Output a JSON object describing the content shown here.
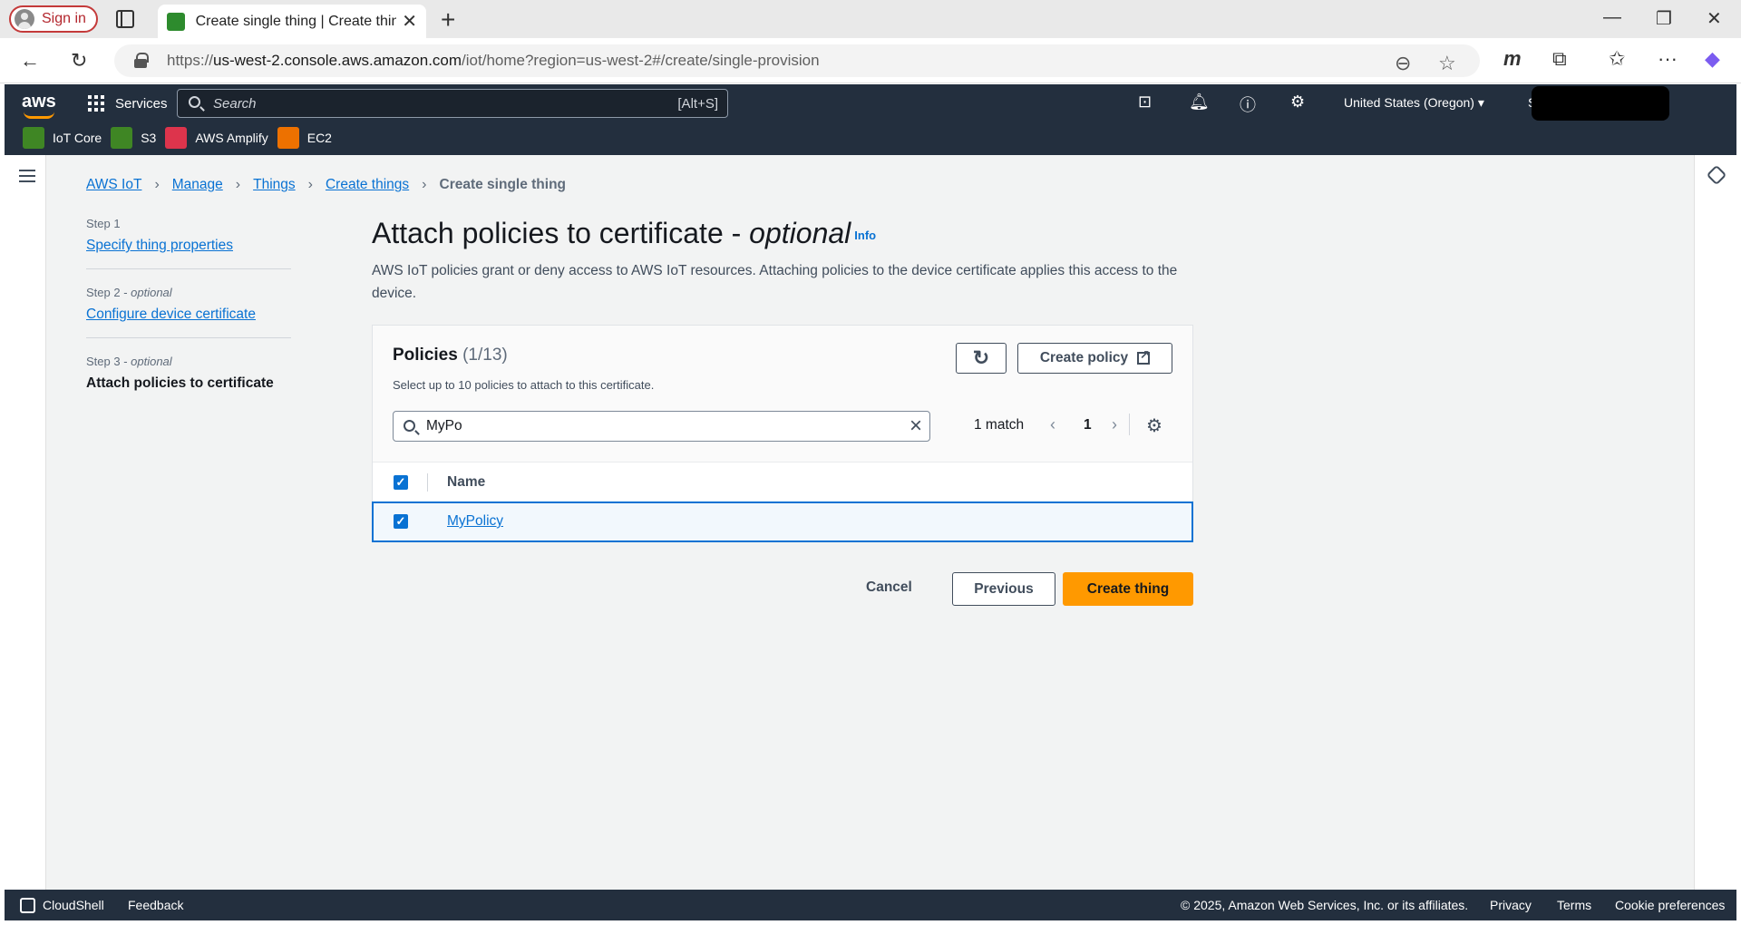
{
  "browser": {
    "signin_label": "Sign in",
    "tab_title": "Create single thing | Create things",
    "url_prefix": "https://",
    "url_domain": "us-west-2.console.aws.amazon.com",
    "url_path": "/iot/home?region=us-west-2#/create/single-provision"
  },
  "aws": {
    "logo": "aws",
    "services_label": "Services",
    "search_placeholder": "Search",
    "search_shortcut": "[Alt+S]",
    "region": "United States (Oregon) ▾",
    "account_initial": "S",
    "favorites": [
      {
        "label": "IoT Core",
        "color": "#3f8624"
      },
      {
        "label": "S3",
        "color": "#3f8624"
      },
      {
        "label": "AWS Amplify",
        "color": "#dd344c"
      },
      {
        "label": "EC2",
        "color": "#ed7100"
      }
    ]
  },
  "breadcrumbs": {
    "items": [
      "AWS IoT",
      "Manage",
      "Things",
      "Create things"
    ],
    "current": "Create single thing"
  },
  "steps": [
    {
      "label": "Step 1",
      "optional": "",
      "title": "Specify thing properties"
    },
    {
      "label": "Step 2 - ",
      "optional": "optional",
      "title": "Configure device certificate"
    },
    {
      "label": "Step 3 - ",
      "optional": "optional",
      "title": "Attach policies to certificate"
    }
  ],
  "main": {
    "title": "Attach policies to certificate - ",
    "title_optional": "optional",
    "info": "Info",
    "description": "AWS IoT policies grant or deny access to AWS IoT resources. Attaching policies to the device certificate applies this access to the device."
  },
  "policies": {
    "title": "Policies",
    "count": "(1/13)",
    "subtitle": "Select up to 10 policies to attach to this certificate.",
    "create_label": "Create policy",
    "search_value": "MyPo",
    "match_text": "1 match",
    "page": "1",
    "column_name": "Name",
    "rows": [
      {
        "name": "MyPolicy",
        "selected": true
      }
    ]
  },
  "actions": {
    "cancel": "Cancel",
    "previous": "Previous",
    "create": "Create thing"
  },
  "footer": {
    "cloudshell": "CloudShell",
    "feedback": "Feedback",
    "copyright": "© 2025, Amazon Web Services, Inc. or its affiliates.",
    "privacy": "Privacy",
    "terms": "Terms",
    "cookies": "Cookie preferences"
  }
}
